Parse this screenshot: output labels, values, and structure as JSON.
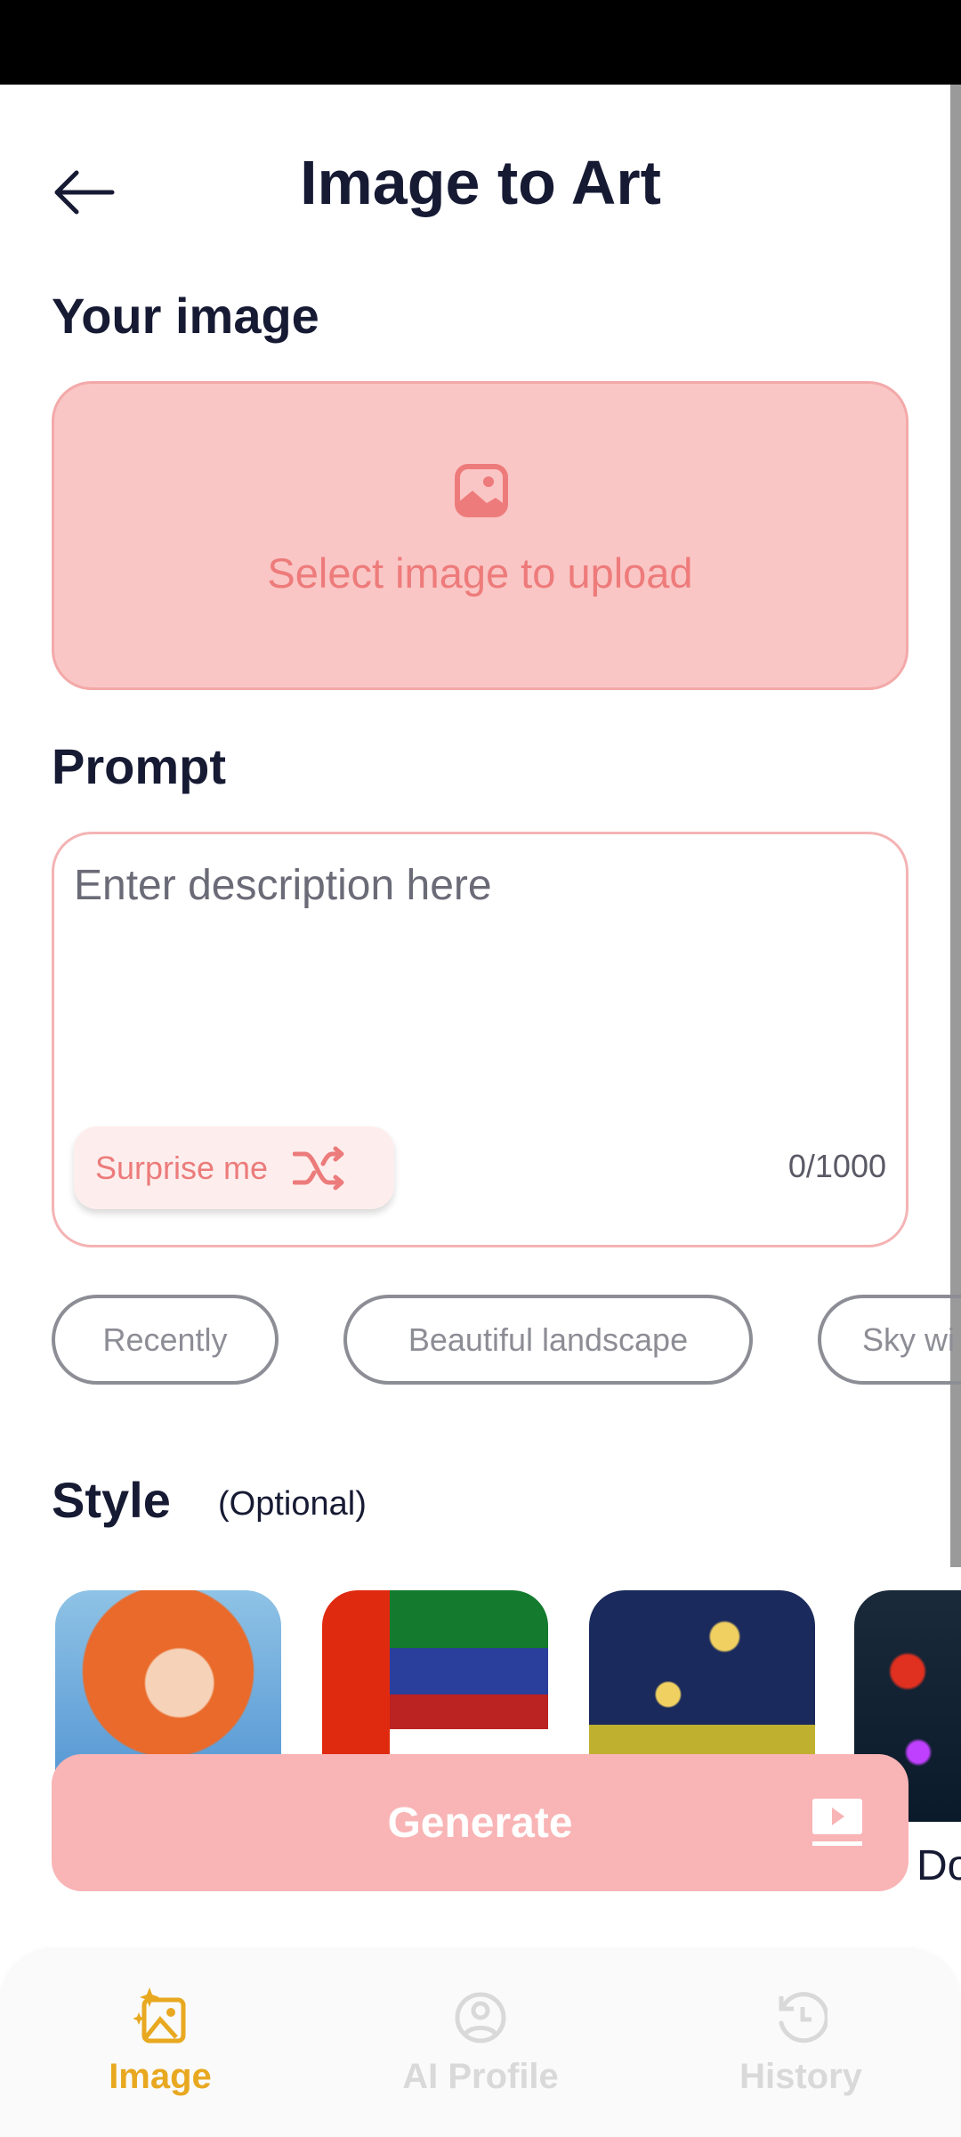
{
  "header": {
    "title": "Image to Art",
    "back_icon": "arrow-left-icon"
  },
  "your_image": {
    "heading": "Your image",
    "upload_label": "Select image to upload",
    "icon": "image-icon"
  },
  "prompt": {
    "heading": "Prompt",
    "placeholder": "Enter description here",
    "value": "",
    "surprise_label": "Surprise me",
    "surprise_icon": "shuffle-icon",
    "counter": "0/1000"
  },
  "suggestions": [
    "Recently",
    "Beautiful landscape",
    "Sky wi"
  ],
  "style": {
    "heading": "Style",
    "optional": "(Optional)",
    "items": [
      {
        "image": "anime-girl"
      },
      {
        "image": "abstract-geometric"
      },
      {
        "image": "starry-night-field"
      },
      {
        "image": "neon-city",
        "label": "Do"
      }
    ]
  },
  "generate": {
    "label": "Generate",
    "icon": "play-ad-icon"
  },
  "nav": {
    "items": [
      {
        "label": "Image",
        "icon": "image-sparkle-icon",
        "active": true
      },
      {
        "label": "AI Profile",
        "icon": "user-circle-icon"
      },
      {
        "label": "History",
        "icon": "history-icon"
      }
    ]
  },
  "colors": {
    "accent": "#F9B4B5",
    "upload_bg": "#F9C6C5",
    "upload_text": "#EE7B7B",
    "nav_active": "#E8A820",
    "nav_inactive": "#D9D9D9",
    "title": "#161A33"
  }
}
